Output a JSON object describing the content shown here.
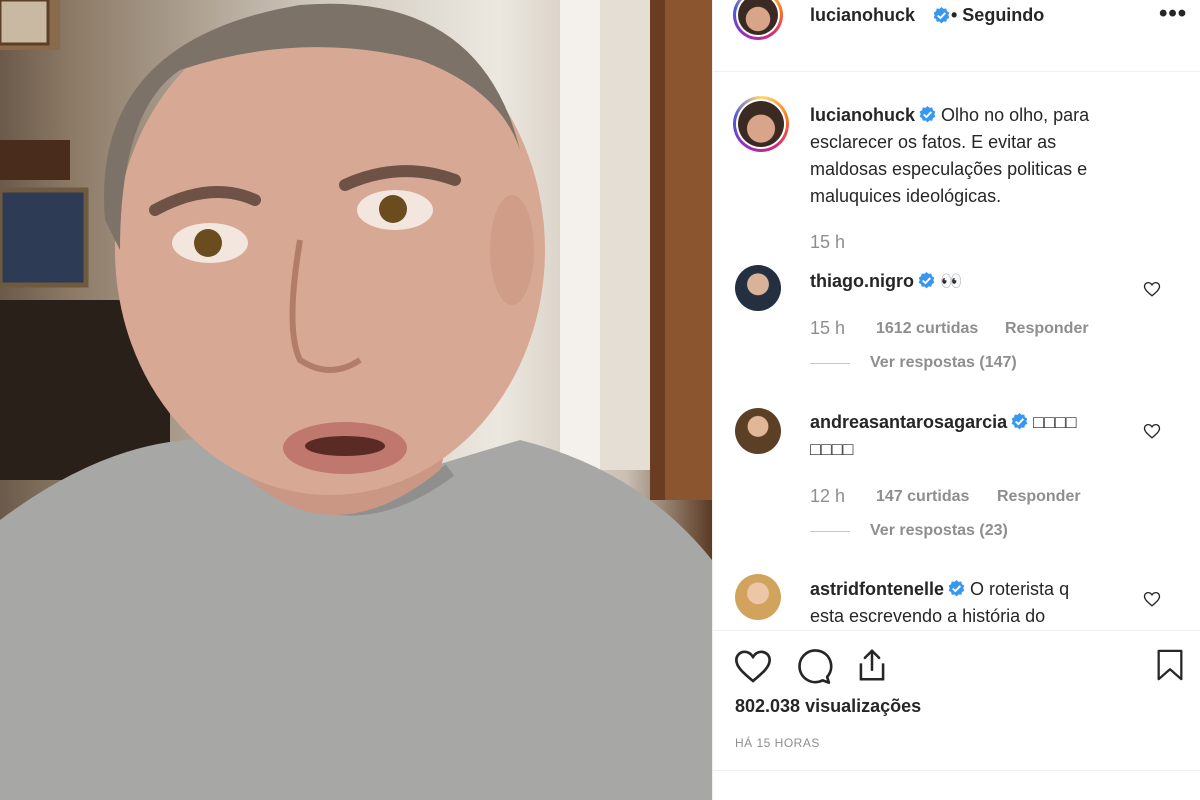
{
  "post": {
    "author": "lucianohuck",
    "follow_status": "• Seguindo",
    "more_label": "•••",
    "caption": "Olho no olho, para esclarecer os fatos. E evitar as maldosas especulações politicas e maluquices ideológicas.",
    "caption_lines": [
      "Olho no olho, para",
      "esclarecer os fatos. E evitar as",
      "maldosas especulações politicas e",
      "maluquices ideológicas."
    ],
    "caption_time": "15 h",
    "views": "802.038 visualizações",
    "posted_ago": "HÁ 15 HORAS"
  },
  "comments": [
    {
      "user": "thiago.nigro",
      "text": "👀",
      "time": "15 h",
      "likes": "1612 curtidas",
      "reply": "Responder",
      "view_replies": "Ver respostas (147)"
    },
    {
      "user": "andreasantarosagarcia",
      "text_line1": "□□□□",
      "text_line2": "□□□□",
      "time": "12 h",
      "likes": "147 curtidas",
      "reply": "Responder",
      "view_replies": "Ver respostas (23)"
    },
    {
      "user": "astridfontenelle",
      "text_line1": "O roteristа q",
      "text_line2": "esta escrevendo a história do"
    }
  ],
  "icons": {
    "like": "heart-icon",
    "comment": "comment-bubble-icon",
    "share": "share-icon",
    "save": "bookmark-icon",
    "verified": "verified-badge-icon"
  },
  "colors": {
    "verified": "#3897f0",
    "muted": "#8e8e8e",
    "text": "#262626"
  }
}
